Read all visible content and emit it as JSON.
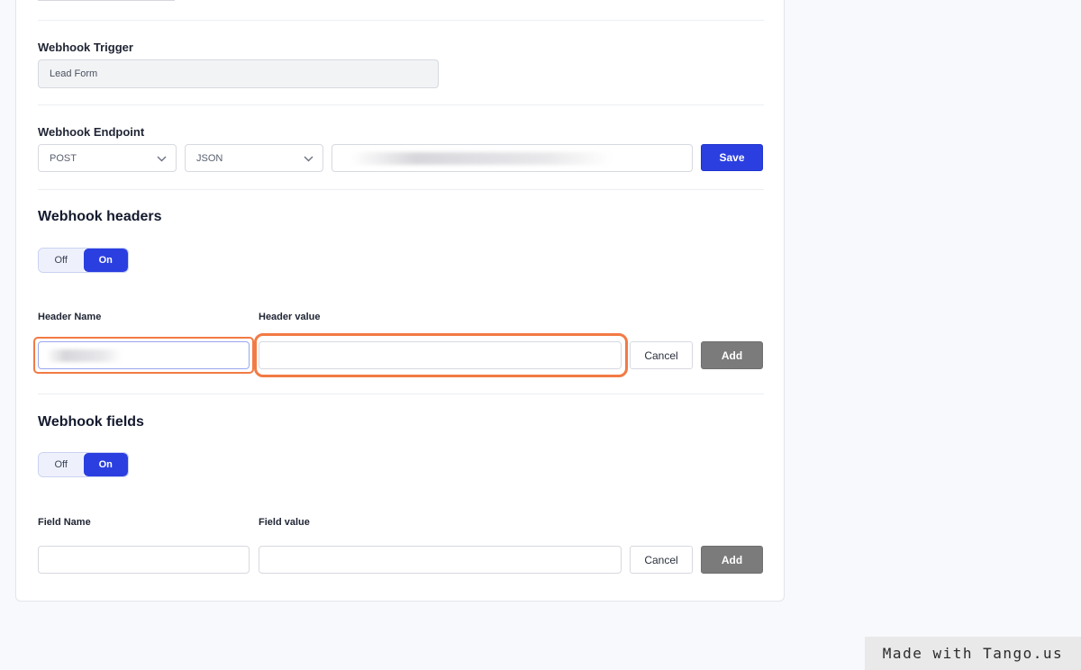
{
  "trigger": {
    "label": "Webhook Trigger",
    "value": "Lead Form"
  },
  "endpoint": {
    "label": "Webhook Endpoint",
    "method": "POST",
    "format": "JSON",
    "url_value": "",
    "save_label": "Save"
  },
  "headers": {
    "title": "Webhook headers",
    "toggle": {
      "off_label": "Off",
      "on_label": "On",
      "selected": "On"
    },
    "name_label": "Header Name",
    "value_label": "Header value",
    "name_value": "",
    "value_value": "",
    "cancel_label": "Cancel",
    "add_label": "Add"
  },
  "fields": {
    "title": "Webhook fields",
    "toggle": {
      "off_label": "Off",
      "on_label": "On",
      "selected": "On"
    },
    "name_label": "Field Name",
    "value_label": "Field value",
    "name_value": "",
    "value_value": "",
    "cancel_label": "Cancel",
    "add_label": "Add"
  },
  "colors": {
    "primary": "#2b3fe0",
    "highlight": "#f27a44",
    "disabled_button": "#7b7b7b"
  },
  "icons": {
    "select_caret": "chevron-down-icon"
  },
  "watermark": "Made with Tango.us"
}
